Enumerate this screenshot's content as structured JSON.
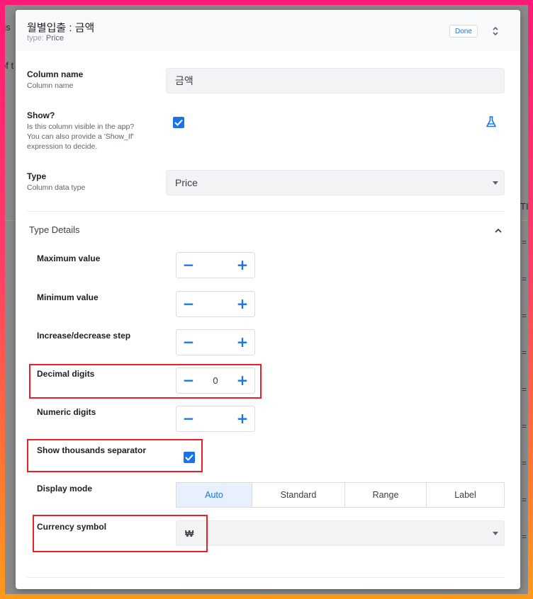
{
  "background": {
    "fragments": [
      "gs",
      "of t",
      "TI"
    ]
  },
  "header": {
    "title": "월별입출 : 금액",
    "type_prefix": "type:",
    "type_value": "Price",
    "done_label": "Done"
  },
  "column_name": {
    "label": "Column name",
    "description": "Column name",
    "value": "금액"
  },
  "show": {
    "label": "Show?",
    "description_lines": [
      "Is this column visible in the app?",
      "You can also provide a 'Show_If'",
      "expression to decide."
    ],
    "checked": true
  },
  "type": {
    "label": "Type",
    "description": "Column data type",
    "value": "Price"
  },
  "type_details": {
    "title": "Type Details",
    "maximum_value": {
      "label": "Maximum value",
      "value": ""
    },
    "minimum_value": {
      "label": "Minimum value",
      "value": ""
    },
    "step": {
      "label": "Increase/decrease step",
      "value": ""
    },
    "decimal_digits": {
      "label": "Decimal digits",
      "value": "0"
    },
    "numeric_digits": {
      "label": "Numeric digits",
      "value": ""
    },
    "thousands_separator": {
      "label": "Show thousands separator",
      "checked": true
    },
    "display_mode": {
      "label": "Display mode",
      "options": [
        "Auto",
        "Standard",
        "Range",
        "Label"
      ],
      "selected": "Auto"
    },
    "currency_symbol": {
      "label": "Currency symbol",
      "value": "₩"
    }
  },
  "colors": {
    "accent": "#1a73e8",
    "highlight": "#e8202a"
  },
  "icons": [
    "chevron-expand-icon",
    "flask-icon",
    "chevron-up-icon",
    "minus-icon",
    "plus-icon",
    "check-icon",
    "dropdown-arrow-icon"
  ]
}
